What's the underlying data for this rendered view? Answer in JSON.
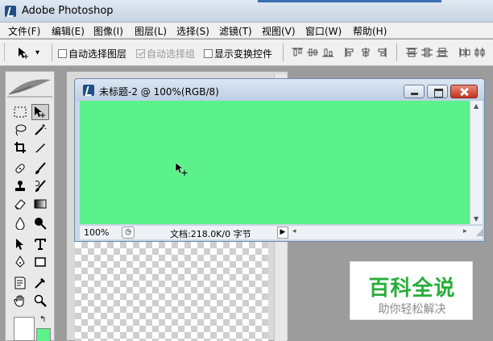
{
  "app": {
    "title": "Adobe Photoshop"
  },
  "menu": [
    "文件(F)",
    "编辑(E)",
    "图像(I)",
    "图层(L)",
    "选择(S)",
    "滤镜(T)",
    "视图(V)",
    "窗口(W)",
    "帮助(H)"
  ],
  "options": {
    "auto_select_layer": "自动选择图层",
    "auto_select_group": "自动选择组",
    "show_transform_controls": "显示变换控件"
  },
  "document": {
    "title": "未标题-2 @ 100%(RGB/8)",
    "canvas_color": "#5bf28b",
    "status_zoom": "100%",
    "status_info": "文档:218.0K/0 字节"
  },
  "colors": {
    "foreground": "#ffffff",
    "background": "#5cf28c"
  },
  "watermark": {
    "main": "百科全说",
    "sub": "助你轻松解决"
  },
  "icons": {
    "move_tool": "move-icon",
    "marquee": "rect-marquee-icon",
    "lasso": "lasso-icon",
    "magic_wand": "magic-wand-icon",
    "crop": "crop-icon",
    "slice": "slice-icon",
    "healing": "healing-brush-icon",
    "brush": "brush-icon",
    "stamp": "clone-stamp-icon",
    "history_brush": "history-brush-icon",
    "eraser": "eraser-icon",
    "gradient": "gradient-icon",
    "blur": "blur-icon",
    "dodge": "dodge-icon",
    "path_select": "path-select-icon",
    "type": "type-icon",
    "pen": "pen-icon",
    "shape": "rectangle-shape-icon",
    "notes": "notes-icon",
    "eyedropper": "eyedropper-icon",
    "hand": "hand-icon",
    "zoom": "zoom-icon"
  }
}
